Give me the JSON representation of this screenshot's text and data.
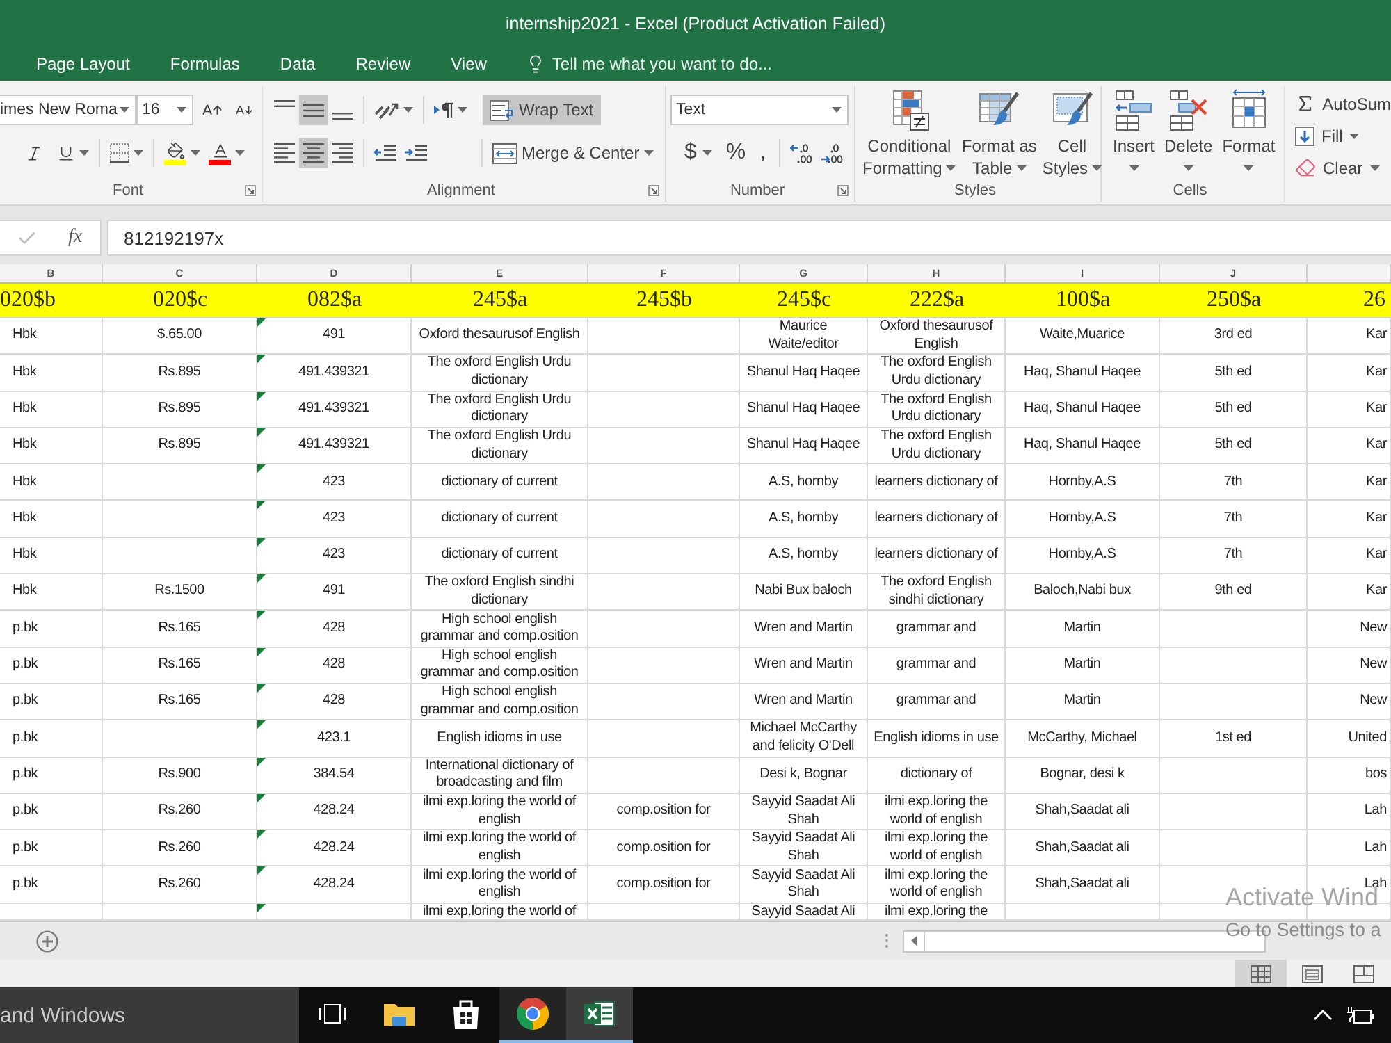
{
  "window": {
    "title": "internship2021 - Excel (Product Activation Failed)"
  },
  "ribbon_tabs": [
    {
      "label": "Page Layout",
      "selected": false
    },
    {
      "label": "Formulas",
      "selected": false
    },
    {
      "label": "Data",
      "selected": false
    },
    {
      "label": "Review",
      "selected": false
    },
    {
      "label": "View",
      "selected": false
    }
  ],
  "tell_me": {
    "placeholder": "Tell me what you want to do..."
  },
  "font_group": {
    "label": "Font",
    "font_name": "imes New Roma",
    "font_size": "16"
  },
  "alignment_group": {
    "label": "Alignment",
    "vertical": [
      {
        "kind": "top",
        "on": false
      },
      {
        "kind": "middle",
        "on": true
      },
      {
        "kind": "bottom",
        "on": false
      }
    ],
    "horizontal": [
      {
        "kind": "left",
        "on": false
      },
      {
        "kind": "center",
        "on": true
      },
      {
        "kind": "right",
        "on": false
      }
    ],
    "wrap_text": {
      "label": "Wrap Text",
      "on": true
    },
    "merge": {
      "label": "Merge & Center"
    }
  },
  "number_group": {
    "label": "Number",
    "format": "Text",
    "symbols": [
      {
        "label": "$",
        "dropdown": true
      },
      {
        "label": "%",
        "dropdown": false
      },
      {
        "label": ",",
        "dropdown": false
      }
    ]
  },
  "styles_group": {
    "label": "Styles",
    "buttons": [
      {
        "kind": "conditional",
        "lines": [
          "Conditional",
          "Formatting"
        ]
      },
      {
        "kind": "table",
        "lines": [
          "Format as",
          "Table"
        ]
      },
      {
        "kind": "cell_styles",
        "lines": [
          "Cell",
          "Styles"
        ]
      }
    ]
  },
  "cells_group": {
    "label": "Cells",
    "buttons": [
      {
        "kind": "insert",
        "label": "Insert"
      },
      {
        "kind": "delete",
        "label": "Delete"
      },
      {
        "kind": "format",
        "label": "Format"
      }
    ]
  },
  "editing_group": {
    "items": [
      {
        "kind": "autosum",
        "label": "AutoSum",
        "dropdown": false
      },
      {
        "kind": "fill",
        "label": "Fill",
        "dropdown": true
      },
      {
        "kind": "clear",
        "label": "Clear",
        "dropdown": true
      }
    ]
  },
  "formula_bar": {
    "function_label": "fx",
    "value": "812192197x"
  },
  "sheet": {
    "column_letters": [
      "B",
      "C",
      "D",
      "E",
      "F",
      "G",
      "H",
      "I",
      "J"
    ],
    "header_row": [
      "020$b",
      "020$c",
      "082$a",
      "245$a",
      "245$b",
      "245$c",
      "222$a",
      "100$a",
      "250$a",
      "26"
    ],
    "rows": [
      {
        "cells": [
          "Hbk",
          "$.65.00",
          "491",
          "Oxford thesaurusof English",
          null,
          "Maurice Waite/editor",
          "Oxford thesaurusof English",
          "Waite,Muarice",
          "3rd ed",
          "Kar"
        ],
        "error_marker": true
      },
      {
        "cells": [
          "Hbk",
          "Rs.895",
          "491.439321",
          "The oxford English Urdu dictionary",
          null,
          "Shanul Haq Haqee",
          "The oxford English Urdu dictionary",
          "Haq, Shanul Haqee",
          "5th ed",
          "Kar"
        ],
        "error_marker": true
      },
      {
        "cells": [
          "Hbk",
          "Rs.895",
          "491.439321",
          "The oxford English Urdu dictionary",
          null,
          "Shanul Haq Haqee",
          "The oxford English Urdu dictionary",
          "Haq, Shanul Haqee",
          "5th ed",
          "Kar"
        ],
        "error_marker": true
      },
      {
        "cells": [
          "Hbk",
          "Rs.895",
          "491.439321",
          "The oxford English Urdu dictionary",
          null,
          "Shanul Haq Haqee",
          "The oxford English Urdu dictionary",
          "Haq, Shanul Haqee",
          "5th ed",
          "Kar"
        ],
        "error_marker": true
      },
      {
        "cells": [
          "Hbk",
          null,
          "423",
          "dictionary of current",
          null,
          "A.S, hornby",
          "learners dictionary of",
          "Hornby,A.S",
          "7th",
          "Kar"
        ],
        "error_marker": true
      },
      {
        "cells": [
          "Hbk",
          null,
          "423",
          "dictionary of current",
          null,
          "A.S, hornby",
          "learners dictionary of",
          "Hornby,A.S",
          "7th",
          "Kar"
        ],
        "error_marker": true
      },
      {
        "cells": [
          "Hbk",
          null,
          "423",
          "dictionary of current",
          null,
          "A.S, hornby",
          "learners dictionary of",
          "Hornby,A.S",
          "7th",
          "Kar"
        ],
        "error_marker": true
      },
      {
        "cells": [
          "Hbk",
          "Rs.1500",
          "491",
          "The oxford English sindhi dictionary",
          null,
          "Nabi Bux baloch",
          "The oxford English sindhi dictionary",
          "Baloch,Nabi bux",
          "9th ed",
          "Kar"
        ],
        "error_marker": true
      },
      {
        "cells": [
          "p.bk",
          "Rs.165",
          "428",
          "High school english grammar and comp.osition",
          null,
          "Wren and Martin",
          "grammar and",
          "Martin",
          null,
          "New"
        ],
        "error_marker": true
      },
      {
        "cells": [
          "p.bk",
          "Rs.165",
          "428",
          "High school english grammar and comp.osition",
          null,
          "Wren and Martin",
          "grammar and",
          "Martin",
          null,
          "New"
        ],
        "error_marker": true
      },
      {
        "cells": [
          "p.bk",
          "Rs.165",
          "428",
          "High school english grammar and comp.osition",
          null,
          "Wren and Martin",
          "grammar and",
          "Martin",
          null,
          "New"
        ],
        "error_marker": true
      },
      {
        "cells": [
          "p.bk",
          null,
          "423.1",
          "English idioms in use",
          null,
          "Michael McCarthy and felicity O'Dell",
          "English idioms in use",
          "McCarthy, Michael",
          "1st ed",
          "United"
        ],
        "error_marker": true
      },
      {
        "cells": [
          "p.bk",
          "Rs.900",
          "384.54",
          "International dictionary of broadcasting and film",
          null,
          "Desi k, Bognar",
          "dictionary of",
          "Bognar, desi k",
          null,
          "bos"
        ],
        "error_marker": true
      },
      {
        "cells": [
          "p.bk",
          "Rs.260",
          "428.24",
          "ilmi exp.loring the world of english",
          "comp.osition for",
          "Sayyid Saadat Ali Shah",
          "ilmi exp.loring the world of english",
          "Shah,Saadat ali",
          null,
          "Lah"
        ],
        "error_marker": true
      },
      {
        "cells": [
          "p.bk",
          "Rs.260",
          "428.24",
          "ilmi exp.loring the world of english",
          "comp.osition for",
          "Sayyid Saadat Ali Shah",
          "ilmi exp.loring the world of english",
          "Shah,Saadat ali",
          null,
          "Lah"
        ],
        "error_marker": true
      },
      {
        "cells": [
          "p.bk",
          "Rs.260",
          "428.24",
          "ilmi exp.loring the world of english",
          "comp.osition for",
          "Sayyid Saadat Ali Shah",
          "ilmi exp.loring the world of english",
          "Shah,Saadat ali",
          null,
          "Lah"
        ],
        "error_marker": true
      },
      {
        "cells": [
          null,
          null,
          null,
          "ilmi exp.loring the world of",
          null,
          "Sayyid Saadat Ali",
          "ilmi exp.loring the",
          null,
          null,
          null
        ],
        "error_marker": true
      }
    ]
  },
  "view_buttons": [
    {
      "kind": "normal",
      "selected": true
    },
    {
      "kind": "page_layout",
      "selected": false
    },
    {
      "kind": "page_break",
      "selected": false
    }
  ],
  "taskbar": {
    "placeholder": "and Windows",
    "apps": [
      {
        "kind": "task_view",
        "running": false,
        "active": false
      },
      {
        "kind": "file_explorer",
        "running": false,
        "active": false
      },
      {
        "kind": "store",
        "running": false,
        "active": false
      },
      {
        "kind": "browser",
        "running": true,
        "active": false
      },
      {
        "kind": "spreadsheet",
        "running": true,
        "active": true
      }
    ]
  },
  "activation_notice": {
    "title": "Activate Wind",
    "subtitle": "Go to Settings to a"
  }
}
